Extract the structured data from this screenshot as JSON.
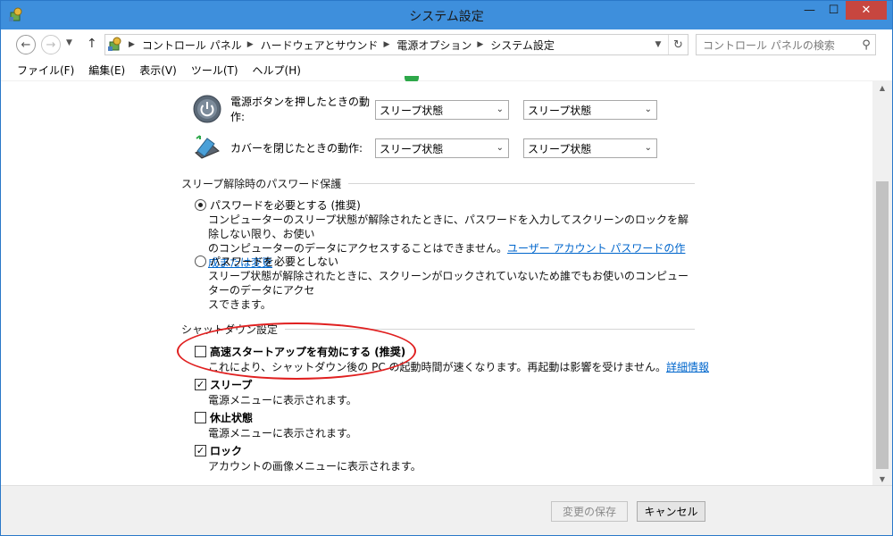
{
  "window": {
    "title": "システム設定"
  },
  "controls": {
    "minimize": "—",
    "maximize": "☐",
    "close": "✕"
  },
  "address": {
    "breadcrumbs": [
      "コントロール パネル",
      "ハードウェアとサウンド",
      "電源オプション",
      "システム設定"
    ],
    "search_placeholder": "コントロール パネルの検索"
  },
  "menu": [
    "ファイル(F)",
    "編集(E)",
    "表示(V)",
    "ツール(T)",
    "ヘルプ(H)"
  ],
  "buttons_settings": {
    "power_button": {
      "label": "電源ボタンを押したときの動作:",
      "battery": "スリープ状態",
      "plugged": "スリープ状態"
    },
    "lid": {
      "label": "カバーを閉じたときの動作:",
      "battery": "スリープ状態",
      "plugged": "スリープ状態"
    }
  },
  "password": {
    "section_title": "スリープ解除時のパスワード保護",
    "require": {
      "label": "パスワードを必要とする (推奨)",
      "desc_line1": "コンピューターのスリープ状態が解除されたときに、パスワードを入力してスクリーンのロックを解除しない限り、お使い",
      "desc_line2": "のコンピューターのデータにアクセスすることはできません。",
      "link": "ユーザー アカウント パスワードの作成または変更",
      "selected": true
    },
    "not_require": {
      "label": "パスワードを必要としない",
      "desc_line1": "スリープ状態が解除されたときに、スクリーンがロックされていないため誰でもお使いのコンピューターのデータにアクセ",
      "desc_line2": "スできます。",
      "selected": false
    }
  },
  "shutdown": {
    "section_title": "シャットダウン設定",
    "fast_startup": {
      "label": "高速スタートアップを有効にする (推奨)",
      "desc": "これにより、シャットダウン後の PC の起動時間が速くなります。再起動は影響を受けません。",
      "link": "詳細情報",
      "checked": false
    },
    "sleep": {
      "label": "スリープ",
      "desc": "電源メニューに表示されます。",
      "checked": true
    },
    "hibernate": {
      "label": "休止状態",
      "desc": "電源メニューに表示されます。",
      "checked": false
    },
    "lock": {
      "label": "ロック",
      "desc": "アカウントの画像メニューに表示されます。",
      "checked": true
    }
  },
  "footer": {
    "save": "変更の保存",
    "cancel": "キャンセル"
  },
  "colors": {
    "titlebar": "#3e8fdc",
    "close": "#c7463f",
    "link": "#0066cc",
    "highlight": "#e02020"
  }
}
